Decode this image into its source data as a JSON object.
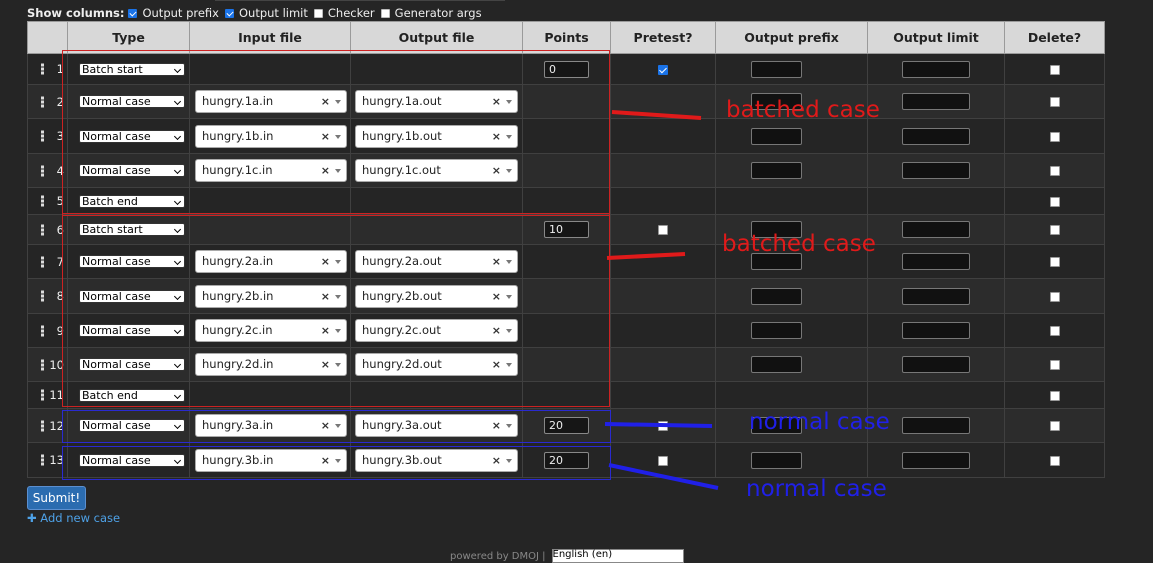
{
  "show_columns": {
    "label": "Show columns:",
    "options": [
      {
        "label": "Output prefix",
        "checked": true
      },
      {
        "label": "Output limit",
        "checked": true
      },
      {
        "label": "Checker",
        "checked": false
      },
      {
        "label": "Generator args",
        "checked": false
      }
    ]
  },
  "table": {
    "headers": [
      "",
      "Type",
      "Input file",
      "Output file",
      "Points",
      "Pretest?",
      "Output prefix",
      "Output limit",
      "Delete?"
    ],
    "rows": [
      {
        "num": "1",
        "type": "Batch start",
        "input": "",
        "output": "",
        "points": "0",
        "pretest": true,
        "showPretest": true
      },
      {
        "num": "2",
        "type": "Normal case",
        "input": "hungry.1a.in",
        "output": "hungry.1a.out",
        "points": null,
        "showPretest": false
      },
      {
        "num": "3",
        "type": "Normal case",
        "input": "hungry.1b.in",
        "output": "hungry.1b.out",
        "points": null,
        "showPretest": false
      },
      {
        "num": "4",
        "type": "Normal case",
        "input": "hungry.1c.in",
        "output": "hungry.1c.out",
        "points": null,
        "showPretest": false
      },
      {
        "num": "5",
        "type": "Batch end",
        "input": "",
        "output": "",
        "points": null,
        "showPretest": false
      },
      {
        "num": "6",
        "type": "Batch start",
        "input": "",
        "output": "",
        "points": "10",
        "pretest": false,
        "showPretest": true
      },
      {
        "num": "7",
        "type": "Normal case",
        "input": "hungry.2a.in",
        "output": "hungry.2a.out",
        "points": null,
        "showPretest": false
      },
      {
        "num": "8",
        "type": "Normal case",
        "input": "hungry.2b.in",
        "output": "hungry.2b.out",
        "points": null,
        "showPretest": false
      },
      {
        "num": "9",
        "type": "Normal case",
        "input": "hungry.2c.in",
        "output": "hungry.2c.out",
        "points": null,
        "showPretest": false
      },
      {
        "num": "10",
        "type": "Normal case",
        "input": "hungry.2d.in",
        "output": "hungry.2d.out",
        "points": null,
        "showPretest": false
      },
      {
        "num": "11",
        "type": "Batch end",
        "input": "",
        "output": "",
        "points": null,
        "showPretest": false
      },
      {
        "num": "12",
        "type": "Normal case",
        "input": "hungry.3a.in",
        "output": "hungry.3a.out",
        "points": "20",
        "pretest": false,
        "showPretest": true
      },
      {
        "num": "13",
        "type": "Normal case",
        "input": "hungry.3b.in",
        "output": "hungry.3b.out",
        "points": "20",
        "pretest": false,
        "showPretest": true
      }
    ]
  },
  "annotations": [
    {
      "text": "batched case",
      "color": "#e01a1a"
    },
    {
      "text": "batched case",
      "color": "#e01a1a"
    },
    {
      "text": "normal case",
      "color": "#2020e8"
    },
    {
      "text": "normal case",
      "color": "#2020e8"
    }
  ],
  "submit_label": "Submit!",
  "add_case_label": "Add new case",
  "footer": {
    "text": "powered by DMOJ |",
    "language": "English (en)"
  }
}
